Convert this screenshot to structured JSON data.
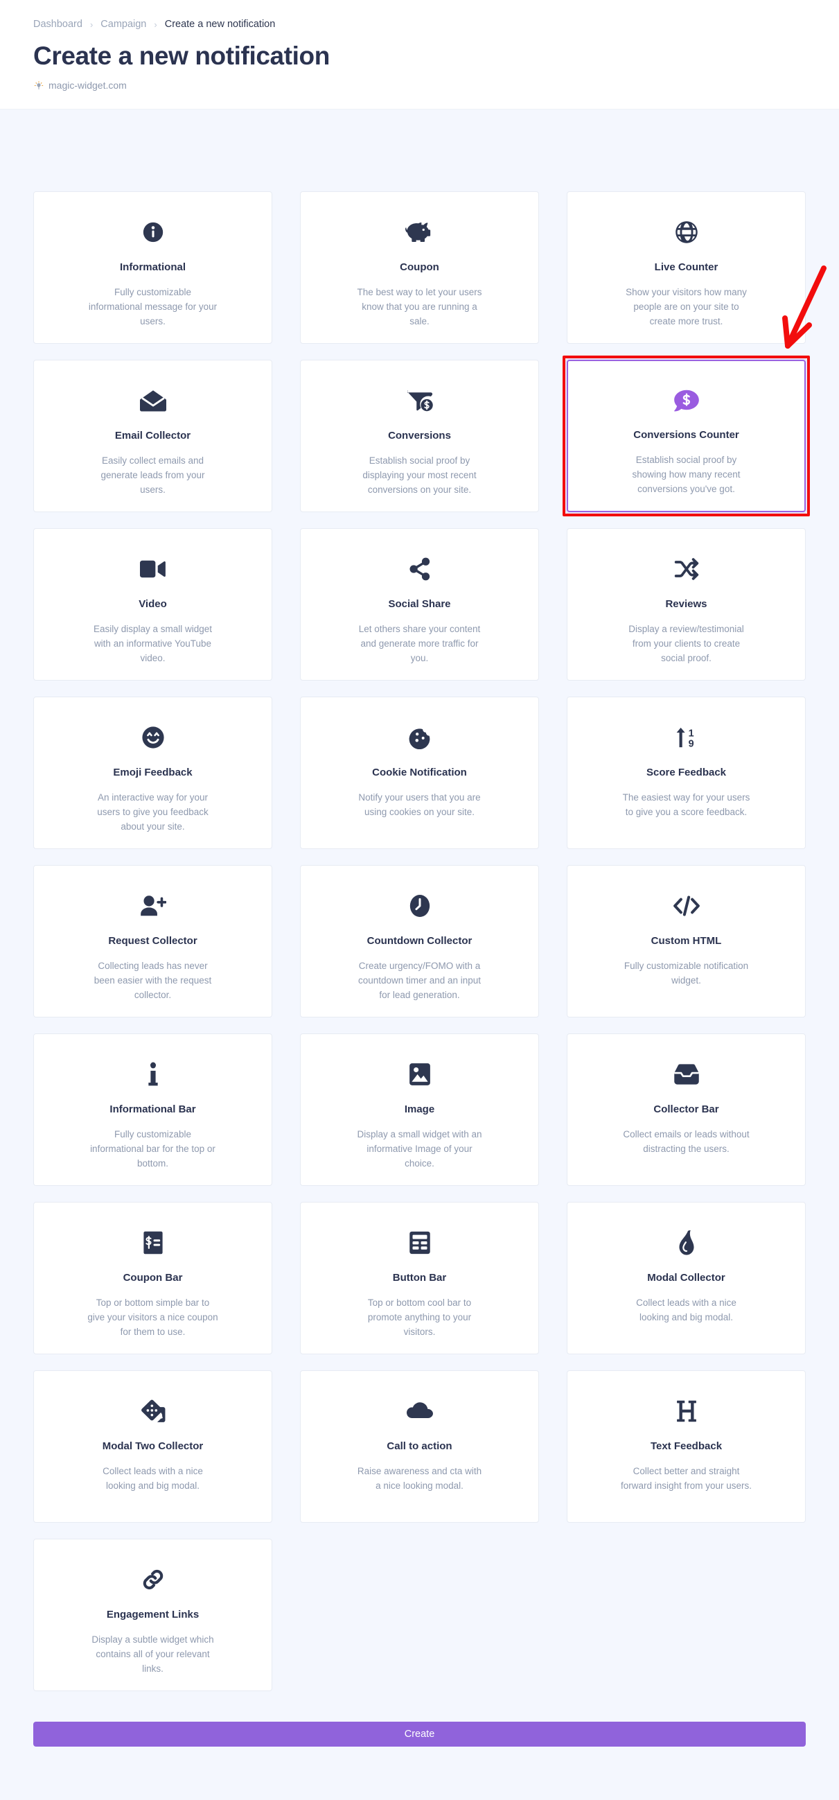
{
  "header": {
    "breadcrumb": {
      "items": [
        "Dashboard",
        "Campaign",
        "Create a new notification"
      ],
      "separator": "›"
    },
    "title": "Create a new notification",
    "site": {
      "icon": "lightbulb-icon",
      "label": "magic-widget.com"
    }
  },
  "colors": {
    "accent": "#9063db",
    "selected_border": "#9a63e0",
    "annotation_red": "#f20d0d",
    "page_background": "#f4f7fe",
    "card_background": "#ffffff",
    "title_text": "#2b3350",
    "body_text": "#8e99ae"
  },
  "cards": [
    {
      "icon": "info-circle-icon",
      "title": "Informational",
      "desc": "Fully customizable informational message for your users.",
      "selected": false
    },
    {
      "icon": "piggy-bank-icon",
      "title": "Coupon",
      "desc": "The best way to let your users know that you are running a sale.",
      "selected": false
    },
    {
      "icon": "globe-icon",
      "title": "Live Counter",
      "desc": "Show your visitors how many people are on your site to create more trust.",
      "selected": false
    },
    {
      "icon": "envelope-open-icon",
      "title": "Email Collector",
      "desc": "Easily collect emails and generate leads from your users.",
      "selected": false
    },
    {
      "icon": "funnel-dollar-icon",
      "title": "Conversions",
      "desc": "Establish social proof by displaying your most recent conversions on your site.",
      "selected": false
    },
    {
      "icon": "comment-dollar-icon",
      "title": "Conversions Counter",
      "desc": "Establish social proof by showing how many recent conversions you've got.",
      "selected": true
    },
    {
      "icon": "video-camera-icon",
      "title": "Video",
      "desc": "Easily display a small widget with an informative YouTube video.",
      "selected": false
    },
    {
      "icon": "share-nodes-icon",
      "title": "Social Share",
      "desc": "Let others share your content and generate more traffic for you.",
      "selected": false
    },
    {
      "icon": "shuffle-icon",
      "title": "Reviews",
      "desc": "Display a review/testimonial from your clients to create social proof.",
      "selected": false
    },
    {
      "icon": "smiley-face-icon",
      "title": "Emoji Feedback",
      "desc": "An interactive way for your users to give you feedback about your site.",
      "selected": false
    },
    {
      "icon": "cookie-icon",
      "title": "Cookie Notification",
      "desc": "Notify your users that you are using cookies on your site.",
      "selected": false
    },
    {
      "icon": "score-arrow-icon",
      "title": "Score Feedback",
      "desc": "The easiest way for your users to give you a score feedback.",
      "selected": false
    },
    {
      "icon": "user-plus-icon",
      "title": "Request Collector",
      "desc": "Collecting leads has never been easier with the request collector.",
      "selected": false
    },
    {
      "icon": "clock-icon",
      "title": "Countdown Collector",
      "desc": "Create urgency/FOMO with a countdown timer and an input for lead generation.",
      "selected": false
    },
    {
      "icon": "code-icon",
      "title": "Custom HTML",
      "desc": "Fully customizable notification widget.",
      "selected": false
    },
    {
      "icon": "info-letter-icon",
      "title": "Informational Bar",
      "desc": "Fully customizable informational bar for the top or bottom.",
      "selected": false
    },
    {
      "icon": "image-icon",
      "title": "Image",
      "desc": "Display a small widget with an informative Image of your choice.",
      "selected": false
    },
    {
      "icon": "inbox-icon",
      "title": "Collector Bar",
      "desc": "Collect emails or leads without distracting the users.",
      "selected": false
    },
    {
      "icon": "receipt-dollar-icon",
      "title": "Coupon Bar",
      "desc": "Top or bottom simple bar to give your visitors a nice coupon for them to use.",
      "selected": false
    },
    {
      "icon": "table-list-icon",
      "title": "Button Bar",
      "desc": "Top or bottom cool bar to promote anything to your visitors.",
      "selected": false
    },
    {
      "icon": "flame-icon",
      "title": "Modal Collector",
      "desc": "Collect leads with a nice looking and big modal.",
      "selected": false
    },
    {
      "icon": "dice-icon",
      "title": "Modal Two Collector",
      "desc": "Collect leads with a nice looking and big modal.",
      "selected": false
    },
    {
      "icon": "cloud-icon",
      "title": "Call to action",
      "desc": "Raise awareness and cta with a nice looking modal.",
      "selected": false
    },
    {
      "icon": "heading-icon",
      "title": "Text Feedback",
      "desc": "Collect better and straight forward insight from your users.",
      "selected": false
    },
    {
      "icon": "link-chain-icon",
      "title": "Engagement Links",
      "desc": "Display a subtle widget which contains all of your relevant links.",
      "selected": false
    }
  ],
  "footer": {
    "create_label": "Create"
  }
}
